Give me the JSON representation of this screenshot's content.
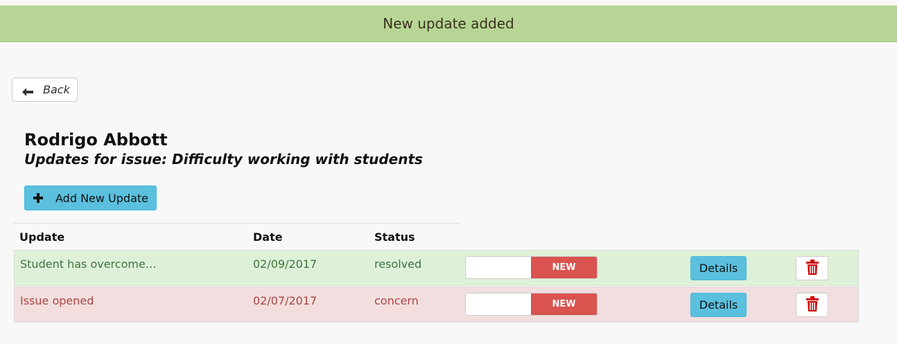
{
  "alert": {
    "message": "New update added"
  },
  "nav": {
    "back_label": "Back",
    "back_icon": "arrow-left-icon"
  },
  "header": {
    "name": "Rodrigo Abbott",
    "subtitle": "Updates for issue: Difficulty working with students"
  },
  "actions": {
    "add_label": "Add New Update",
    "add_icon": "plus-icon"
  },
  "table": {
    "columns": [
      "Update",
      "Date",
      "Status"
    ],
    "rows": [
      {
        "update": "Student has overcome…",
        "date": "02/09/2017",
        "status": "resolved",
        "toggle_label": "NEW",
        "details_label": "Details",
        "row_style": "success"
      },
      {
        "update": "Issue opened",
        "date": "02/07/2017",
        "status": "concern",
        "toggle_label": "NEW",
        "details_label": "Details",
        "row_style": "danger"
      }
    ]
  },
  "colors": {
    "alert_bg": "#b7d594",
    "info_button": "#5bc0de",
    "danger_toggle": "#d9534f",
    "success_row": "#dff0d8",
    "danger_row": "#f2dede",
    "trash_icon": "#cc0000"
  }
}
